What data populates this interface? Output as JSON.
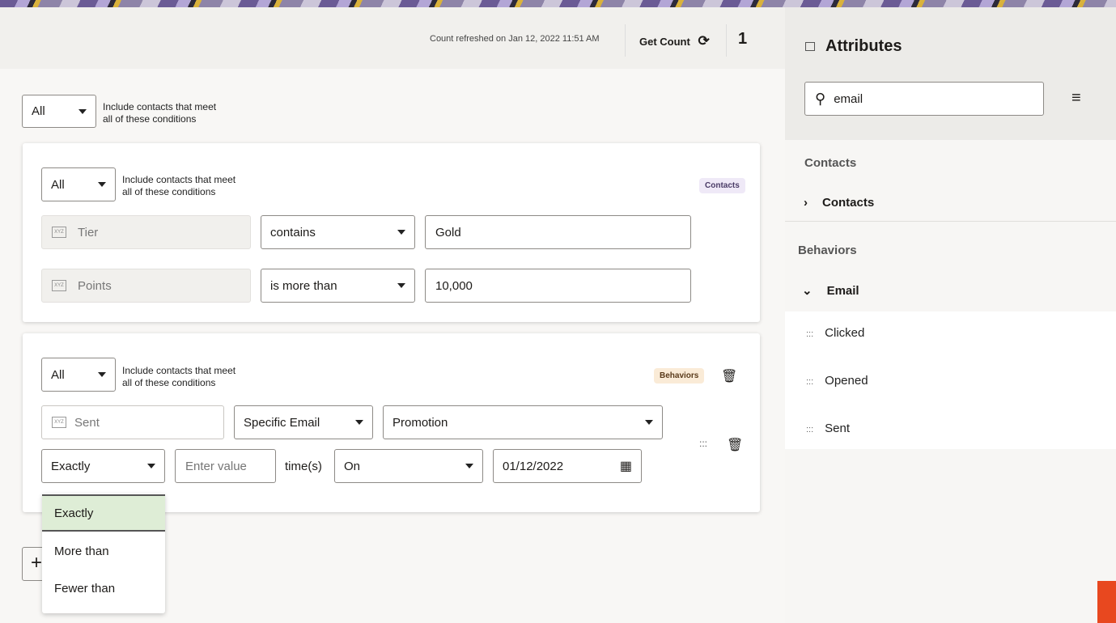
{
  "header": {
    "refresh_text": "Count refreshed on Jan 12, 2022 11:51 AM",
    "get_count": "Get Count",
    "count": "1"
  },
  "root": {
    "match": "All",
    "desc1": "Include contacts that meet",
    "desc2": "all of these conditions"
  },
  "group1": {
    "match": "All",
    "desc1": "Include contacts that meet",
    "desc2": "all of these conditions",
    "badge": "Contacts",
    "rows": [
      {
        "attr": "Tier",
        "op": "contains",
        "value": "Gold"
      },
      {
        "attr": "Points",
        "op": "is more than",
        "value": "10,000"
      }
    ]
  },
  "group2": {
    "match": "All",
    "desc1": "Include contacts that meet",
    "desc2": "all of these conditions",
    "badge": "Behaviors",
    "attr": "Sent",
    "mode": "Specific Email",
    "email": "Promotion",
    "freq": "Exactly",
    "freq_placeholder": "Enter value",
    "times": "time(s)",
    "date_op": "On",
    "date": "01/12/2022"
  },
  "freq_menu": [
    "Exactly",
    "More than",
    "Fewer than"
  ],
  "attributes": {
    "title": "Attributes",
    "search": "email",
    "sections": [
      {
        "label": "Contacts",
        "item": "Contacts"
      },
      {
        "label": "Behaviors",
        "item": "Email"
      }
    ],
    "leaves": [
      "Clicked",
      "Opened",
      "Sent"
    ]
  },
  "colors": {
    "contacts_badge": "#efe9f7",
    "behaviors_badge": "#faebd7",
    "selected": "#deedd6",
    "accent_orange": "#e8481f"
  }
}
